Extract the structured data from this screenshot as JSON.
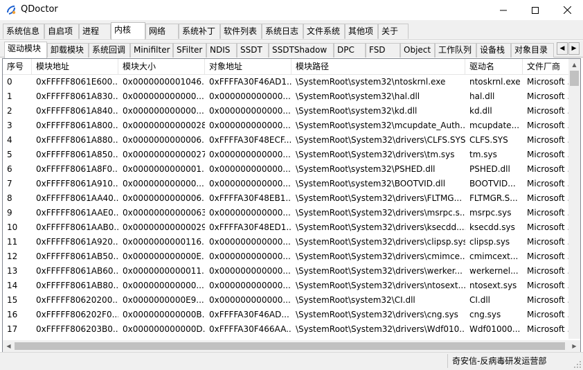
{
  "window": {
    "title": "QDoctor"
  },
  "main_tabs": [
    "系统信息",
    "自启项",
    "进程",
    "内核",
    "网络",
    "系统补丁",
    "软件列表",
    "系统日志",
    "文件系统",
    "其他项",
    "关于"
  ],
  "main_tab_active": "内核",
  "sub_tabs": [
    "驱动模块",
    "卸载模块",
    "系统回调",
    "Minifilter",
    "SFilter",
    "NDIS",
    "SSDT",
    "SSDTShadow",
    "DPC",
    "FSD",
    "Object",
    "工作队列",
    "设备栈",
    "对象目录"
  ],
  "sub_tab_active": "驱动模块",
  "table": {
    "columns": [
      "序号",
      "模块地址",
      "模块大小",
      "对象地址",
      "模块路径",
      "驱动名",
      "文件厂商"
    ],
    "rows": [
      [
        "0",
        "0xFFFFF8061E600...",
        "0x0000000001046...",
        "0xFFFFA30F46AD1...",
        "\\SystemRoot\\system32\\ntoskrnl.exe",
        "ntoskrnl.exe",
        "Microsoft ..."
      ],
      [
        "1",
        "0xFFFFF8061A830...",
        "0x000000000000...",
        "0x000000000000...",
        "\\SystemRoot\\system32\\hal.dll",
        "hal.dll",
        "Microsoft ..."
      ],
      [
        "2",
        "0xFFFFF8061A840...",
        "0x000000000000...",
        "0x000000000000...",
        "\\SystemRoot\\system32\\kd.dll",
        "kd.dll",
        "Microsoft ..."
      ],
      [
        "3",
        "0xFFFFF8061A800...",
        "0x00000000000028...",
        "0x000000000000...",
        "\\SystemRoot\\system32\\mcupdate_Auth...",
        "mcupdate...",
        "Microsoft ..."
      ],
      [
        "4",
        "0xFFFFF8061A880...",
        "0x0000000000006...",
        "0xFFFFA30F48ECF...",
        "\\SystemRoot\\System32\\drivers\\CLFS.SYS",
        "CLFS.SYS",
        "Microsoft ..."
      ],
      [
        "5",
        "0xFFFFF8061A850...",
        "0x00000000000027...",
        "0x000000000000...",
        "\\SystemRoot\\System32\\drivers\\tm.sys",
        "tm.sys",
        "Microsoft ..."
      ],
      [
        "6",
        "0xFFFFF8061A8F0...",
        "0x0000000000001...",
        "0x000000000000...",
        "\\SystemRoot\\system32\\PSHED.dll",
        "PSHED.dll",
        "Microsoft ..."
      ],
      [
        "7",
        "0xFFFFF8061A910...",
        "0x000000000000...",
        "0x000000000000...",
        "\\SystemRoot\\system32\\BOOTVID.dll",
        "BOOTVID...",
        "Microsoft ..."
      ],
      [
        "8",
        "0xFFFFF8061AA40...",
        "0x0000000000006...",
        "0xFFFFA30F48EB1...",
        "\\SystemRoot\\System32\\drivers\\FLTMG...",
        "FLTMGR.S...",
        "Microsoft ..."
      ],
      [
        "9",
        "0xFFFFF8061AAE0...",
        "0x00000000000063...",
        "0x000000000000...",
        "\\SystemRoot\\System32\\drivers\\msrpc.s...",
        "msrpc.sys",
        "Microsoft ..."
      ],
      [
        "10",
        "0xFFFFF8061AAB0...",
        "0x00000000000029...",
        "0xFFFFA30F48ED1...",
        "\\SystemRoot\\System32\\drivers\\ksecdd....",
        "ksecdd.sys",
        "Microsoft ..."
      ],
      [
        "11",
        "0xFFFFF8061A920...",
        "0x0000000000116...",
        "0x000000000000...",
        "\\SystemRoot\\System32\\drivers\\clipsp.sys",
        "clipsp.sys",
        "Microsoft ..."
      ],
      [
        "12",
        "0xFFFFF8061AB50...",
        "0x000000000000E...",
        "0x000000000000...",
        "\\SystemRoot\\System32\\drivers\\cmimce...",
        "cmimcext...",
        "Microsoft ..."
      ],
      [
        "13",
        "0xFFFFF8061AB60...",
        "0x0000000000011...",
        "0x000000000000...",
        "\\SystemRoot\\System32\\drivers\\werker...",
        "werkernel...",
        "Microsoft ..."
      ],
      [
        "14",
        "0xFFFFF8061AB80...",
        "0x000000000000...",
        "0x000000000000...",
        "\\SystemRoot\\System32\\drivers\\ntosext...",
        "ntosext.sys",
        "Microsoft ..."
      ],
      [
        "15",
        "0xFFFFF80620200...",
        "0x0000000000E9...",
        "0x000000000000...",
        "\\SystemRoot\\system32\\CI.dll",
        "CI.dll",
        "Microsoft ..."
      ],
      [
        "16",
        "0xFFFFF806202F0...",
        "0x000000000000B...",
        "0xFFFFA30F46AD...",
        "\\SystemRoot\\System32\\drivers\\cng.sys",
        "cng.sys",
        "Microsoft ..."
      ],
      [
        "17",
        "0xFFFFF806203B0...",
        "0x000000000000D...",
        "0xFFFFA30F466AA...",
        "\\SystemRoot\\System32\\drivers\\Wdf010...",
        "Wdf01000...",
        "Microsoft ..."
      ]
    ]
  },
  "status": {
    "text": "奇安信-反病毒研发运营部"
  },
  "icons": {
    "app": "qdoctor-logo-icon",
    "minimize": "minimize-icon",
    "maximize": "maximize-icon",
    "close": "close-icon"
  },
  "colors": {
    "logo_blue": "#1a5fd0",
    "logo_orange": "#f2a33a"
  }
}
